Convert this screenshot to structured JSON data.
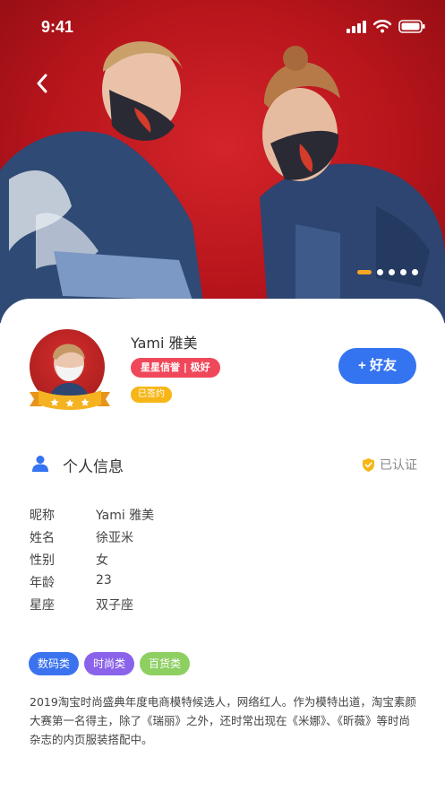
{
  "status": {
    "time": "9:41"
  },
  "carousel": {
    "slides": 5,
    "active_index": 0
  },
  "profile": {
    "name": "Yami 雅美",
    "credit_badge": "星星信誉 | 极好",
    "signed_badge": "已签约",
    "add_friend_label": "+ 好友"
  },
  "section": {
    "title": "个人信息",
    "verified_label": "已认证"
  },
  "info": [
    {
      "label": "昵称",
      "value": "Yami 雅美"
    },
    {
      "label": "姓名",
      "value": "徐亚米"
    },
    {
      "label": "性别",
      "value": "女"
    },
    {
      "label": "年龄",
      "value": "23"
    },
    {
      "label": "星座",
      "value": "双子座"
    }
  ],
  "tags": [
    {
      "label": "数码类",
      "color": "#3b73ef"
    },
    {
      "label": "时尚类",
      "color": "#8b63ea"
    },
    {
      "label": "百货类",
      "color": "#8ecf62"
    }
  ],
  "bio": "2019淘宝时尚盛典年度电商模特候选人，网络红人。作为模特出道，淘宝素颜大赛第一名得主，除了《瑞丽》之外，还时常出现在《米娜》、《昕薇》等时尚杂志的内页服装搭配中。",
  "colors": {
    "accent": "#3574f0",
    "credit": "#f0485b",
    "signed": "#f7b617",
    "verified": "#f7b617",
    "hero": "#c41c22"
  }
}
